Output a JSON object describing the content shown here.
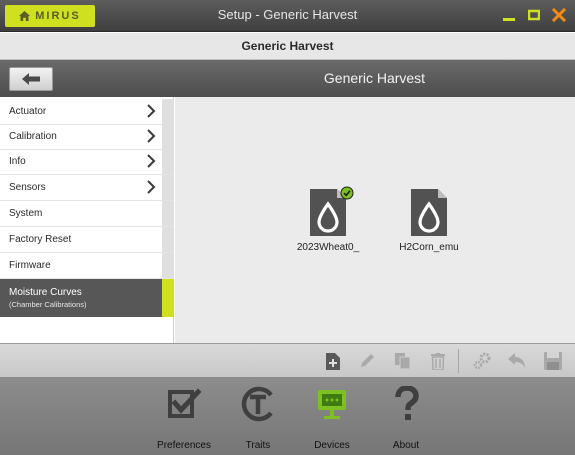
{
  "titlebar": {
    "brand": "MIRUS",
    "title": "Setup - Generic Harvest"
  },
  "header": {
    "title": "Generic Harvest"
  },
  "navbar": {
    "title": "Generic Harvest"
  },
  "sidebar": {
    "items": [
      {
        "label": "Actuator"
      },
      {
        "label": "Calibration"
      },
      {
        "label": "Info"
      },
      {
        "label": "Sensors"
      },
      {
        "label": "System"
      },
      {
        "label": "Factory Reset"
      },
      {
        "label": "Firmware"
      }
    ],
    "selected": {
      "label": "Moisture Curves",
      "sublabel": "(Chamber Calibrations)"
    }
  },
  "files": [
    {
      "name": "2023Wheat0_",
      "status": "active"
    },
    {
      "name": "H2Corn_emu"
    }
  ],
  "toolbar": {
    "icons": [
      "add-file-icon",
      "edit-icon",
      "copy-icon",
      "delete-icon",
      "settings-icon",
      "undo-icon",
      "save-icon"
    ]
  },
  "dock": {
    "items": [
      {
        "label": "Preferences"
      },
      {
        "label": "Traits"
      },
      {
        "label": "Devices"
      },
      {
        "label": "About"
      }
    ]
  },
  "colors": {
    "accent": "#cfe021",
    "active": "#7cc021",
    "dark": "#4d4d4d"
  }
}
